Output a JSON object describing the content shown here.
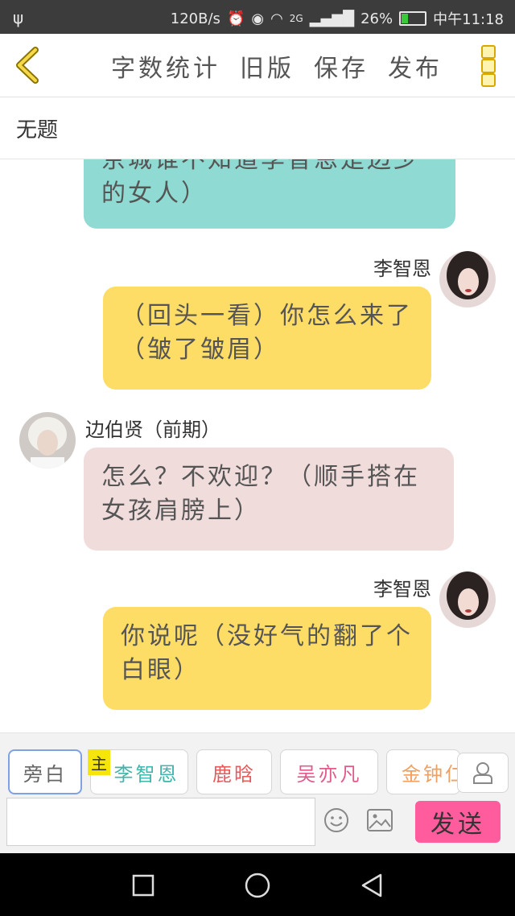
{
  "status_bar": {
    "speed": "120B/s",
    "network": "2G",
    "battery": "26%",
    "battery_level": 0.26,
    "time": "中午11:18",
    "usb_icon": "usb-icon"
  },
  "toolbar": {
    "back_icon": "chevron-left-icon",
    "items": [
      "字数统计",
      "旧版",
      "保存",
      "发布"
    ],
    "more_icon": "more-vertical-icon"
  },
  "doc": {
    "title": "无题"
  },
  "messages": [
    {
      "side": "left",
      "color": "#8fdad2",
      "text": "京城谁不知道李智恩是边少的女人）"
    },
    {
      "side": "right",
      "sender": "李智恩",
      "color": "#fedd66",
      "text": "（回头一看）你怎么来了（皱了皱眉）"
    },
    {
      "side": "left",
      "sender": "边伯贤（前期）",
      "color": "#f1dcdc",
      "text": "怎么？不欢迎？（顺手搭在女孩肩膀上）"
    },
    {
      "side": "right",
      "sender": "李智恩",
      "color": "#fedd66",
      "text": "你说呢（没好气的翻了个白眼）"
    }
  ],
  "roles": [
    {
      "label": "旁白",
      "color": "#666666",
      "active": true
    },
    {
      "label": "李智恩",
      "color": "#40b6aa",
      "badge": "主"
    },
    {
      "label": "鹿晗",
      "color": "#e85a5a"
    },
    {
      "label": "吴亦凡",
      "color": "#e05b8c"
    },
    {
      "label": "金钟仁",
      "color": "#f0a060"
    }
  ],
  "composer": {
    "value": "",
    "placeholder": "",
    "send_label": "发送",
    "send_color": "#ff5c9e"
  },
  "icons": {
    "emoji": "smiley-icon",
    "image": "image-icon",
    "person": "person-icon"
  },
  "nav": {
    "icons": [
      "square-icon",
      "circle-icon",
      "triangle-back-icon"
    ]
  }
}
